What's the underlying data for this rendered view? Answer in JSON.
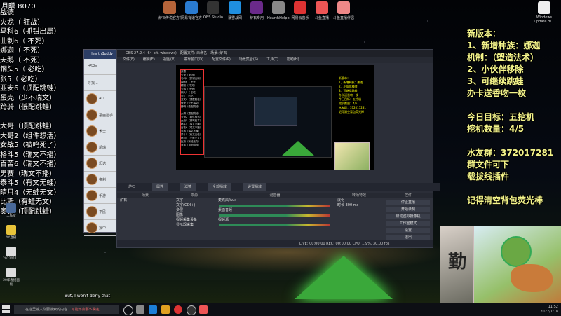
{
  "top_title": "月曦 8070",
  "left_list": [
    "战德  ",
    "火龙（ 狂战）",
    "马科6（抓钳出局）",
    "曲刺6（ 不死）",
    "娜迦（ 不死）",
    "天鹅（ 不死）",
    "钢头5（ 必吃）",
    "张5（ 必吃）",
    "亚安6（顶配跳蛙）",
    "蛋壳（少不瑞文）",
    "跨骑（低配跳蛙）",
    "",
    "大哥（顶配跳蛙）",
    "大哥2（组件想活）",
    "女战5（被鸣死了）",
    "格斗5（瑞文不播）",
    "百苦6（瑞文不播）",
    "男赛（瑞文不播）",
    "泰斗5（有文无蛙）",
    "晴月4（无蛙无文）",
    "比斯（有蛙无文）",
    "奥诺（顶配跳蛙）"
  ],
  "right_overlay": {
    "lines_1": [
      "新版本：",
      "1、新增种族：娜迦",
      "机制：（塑造法术）",
      "2、小伙伴移除",
      "3、可继续跳蛙",
      "办卡送香吻一枚"
    ],
    "lines_2": [
      "今日目标：五挖机",
      "挖机数量：4/5"
    ],
    "lines_3": [
      "水友群：372017281",
      "群文件可下",
      "载拔线插件"
    ],
    "lines_4": [
      "记得清空背包荧光棒"
    ]
  },
  "desktop_icons_top": [
    {
      "label": "炉石传说官方插件",
      "color": "#b5643a"
    },
    {
      "label": "网易有道官方",
      "color": "#2a7bd1"
    },
    {
      "label": "OBS Studio",
      "color": "#333"
    },
    {
      "label": "暴雪战网",
      "color": "#1f8fe0"
    },
    {
      "label": "炉石专用",
      "color": "#6a2a8a"
    },
    {
      "label": "HearthHelper - 炉石小助手",
      "color": "#888"
    },
    {
      "label": "网易云音乐",
      "color": "#d33"
    },
    {
      "label": "斗鱼直播",
      "color": "#e55"
    },
    {
      "label": "斗鱼直播伴侣",
      "color": "#e88"
    }
  ],
  "recycle": "Windows Update Bl...",
  "hs_window": {
    "title": "HearthBuddy",
    "items": [
      "HSRe...",
      "寻找...",
      "ALL",
      "恶魔猎手",
      "术士",
      "凯瑞",
      "坦诺",
      "奥利",
      "手游",
      "平民",
      "找中"
    ]
  },
  "obs": {
    "title": "OBS 27.2.4 (64-bit, windows) - 配置文件: 未命名 - 场景: 炉石",
    "menu": [
      "文件(F)",
      "编辑(E)",
      "视图(V)",
      "停靠窗口(D)",
      "配置文件(P)",
      "场景集合(S)",
      "工具(T)",
      "帮助(H)"
    ],
    "preview_text": [
      "新版本：",
      "1、新增种族：娜迦",
      "2、小伙伴移除",
      "3、可继续跳蛙",
      "办卡送香吻一枚",
      "今日目标：五挖机",
      "挖机数量：4/5",
      "水友群：372017281",
      "记得清空背包荧光棒"
    ],
    "info": [
      "炉石",
      "属性",
      "滤镜",
      "全部播放",
      "设置播放"
    ],
    "docks": {
      "scenes": {
        "header": "场景",
        "items": [
          "炉石"
        ]
      },
      "sources": {
        "header": "来源",
        "items": [
          "文字",
          "文字(GDI+)",
          "多层",
          "图像",
          "视频采集设备",
          "显示器采集"
        ]
      },
      "mixer": {
        "header": "混音器",
        "items": [
          "麦克风/Aux",
          "桌面音频",
          "视频源"
        ]
      },
      "transitions": {
        "header": "转场特效",
        "items": [
          "淡化",
          "时长 300 ms"
        ]
      },
      "controls": {
        "header": "控件",
        "items": [
          "停止直播",
          "开始录制",
          "启动虚拟摄像机",
          "工作室模式",
          "设置",
          "退出"
        ]
      }
    },
    "status": "LIVE: 00:00:00  REC: 00:00:00  CPU: 1.9%, 30.00 fps"
  },
  "caption": "But, I won't deny that",
  "left_icons": [
    "工作室",
    "YY直播",
    "2022011...",
    "20年春招面板"
  ],
  "taskbar": {
    "search_placeholder": "在这里输入你要搜索的内容",
    "search_overlay": "可能不会那么确定",
    "tray_time": "11:52",
    "tray_date": "2022/1/18"
  }
}
